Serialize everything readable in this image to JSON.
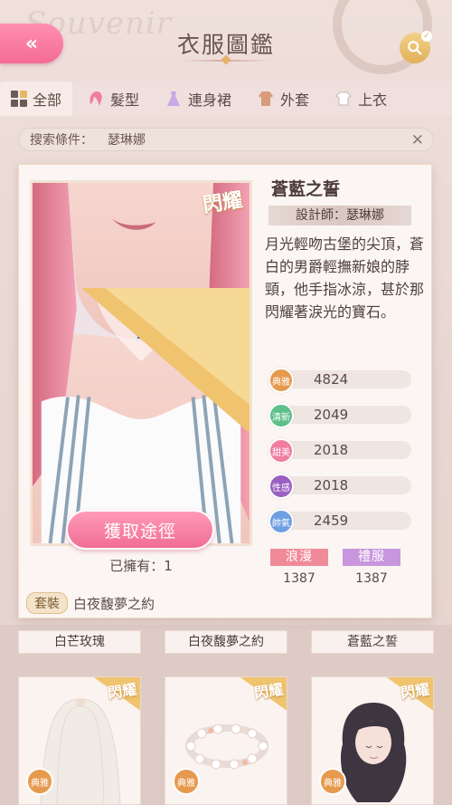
{
  "header": {
    "title": "衣服圖鑑",
    "back_label": "«"
  },
  "tabs": [
    {
      "label": "全部",
      "icon": "grid-icon",
      "active": true
    },
    {
      "label": "髮型",
      "icon": "hair-icon"
    },
    {
      "label": "連身裙",
      "icon": "dress-icon"
    },
    {
      "label": "外套",
      "icon": "coat-icon"
    },
    {
      "label": "上衣",
      "icon": "shirt-icon"
    }
  ],
  "filter": {
    "label": "搜索條件：",
    "value": "瑟琳娜",
    "clear": "✕"
  },
  "detail": {
    "rarity": "閃耀",
    "name": "蒼藍之誓",
    "designer": "設計師：瑟琳娜",
    "description": "月光輕吻古堡的尖頂，蒼白的男爵輕撫新娘的脖頸，他手指冰涼，甚於那閃耀著淚光的寶石。",
    "obtain_button": "獲取途徑",
    "owned": "已擁有：1",
    "set_badge": "套裝",
    "set_name": "白夜馥夢之約",
    "stats": [
      {
        "badge": "典雅",
        "value": "4824",
        "color": "#e69a4e"
      },
      {
        "badge": "清新",
        "value": "2049",
        "color": "#5fbf8a"
      },
      {
        "badge": "甜美",
        "value": "2018",
        "color": "#f07ea2"
      },
      {
        "badge": "性感",
        "value": "2018",
        "color": "#9a5fc0"
      },
      {
        "badge": "帥氣",
        "value": "2459",
        "color": "#6f9fe0"
      }
    ],
    "tags": [
      {
        "label": "浪漫",
        "value": "1387",
        "color": "#f08a98"
      },
      {
        "label": "禮服",
        "value": "1387",
        "color": "#c796dc"
      }
    ]
  },
  "grid_names": [
    "白芒玫瑰",
    "白夜馥夢之約",
    "蒼藍之誓"
  ],
  "grid_items": [
    {
      "rarity": "閃耀",
      "style": "典雅",
      "art": "veil"
    },
    {
      "rarity": "閃耀",
      "style": "典雅",
      "art": "wreath"
    },
    {
      "rarity": "閃耀",
      "style": "典雅",
      "art": "curly-hair"
    }
  ]
}
